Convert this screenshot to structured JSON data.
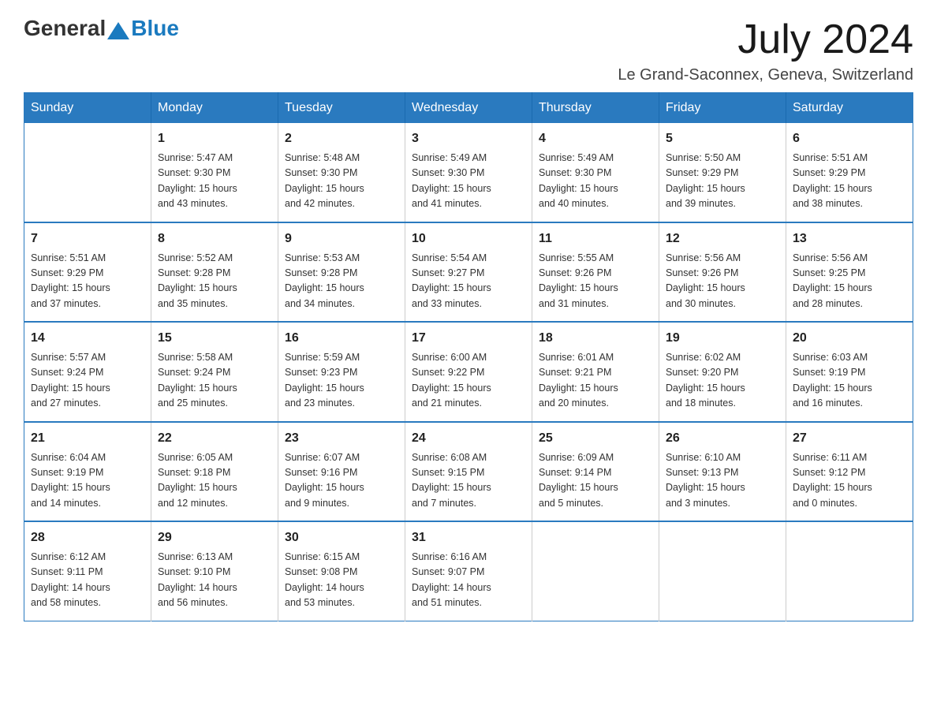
{
  "logo": {
    "general": "General",
    "blue": "Blue"
  },
  "header": {
    "month_year": "July 2024",
    "location": "Le Grand-Saconnex, Geneva, Switzerland"
  },
  "days_of_week": [
    "Sunday",
    "Monday",
    "Tuesday",
    "Wednesday",
    "Thursday",
    "Friday",
    "Saturday"
  ],
  "weeks": [
    [
      {
        "day": "",
        "info": ""
      },
      {
        "day": "1",
        "info": "Sunrise: 5:47 AM\nSunset: 9:30 PM\nDaylight: 15 hours\nand 43 minutes."
      },
      {
        "day": "2",
        "info": "Sunrise: 5:48 AM\nSunset: 9:30 PM\nDaylight: 15 hours\nand 42 minutes."
      },
      {
        "day": "3",
        "info": "Sunrise: 5:49 AM\nSunset: 9:30 PM\nDaylight: 15 hours\nand 41 minutes."
      },
      {
        "day": "4",
        "info": "Sunrise: 5:49 AM\nSunset: 9:30 PM\nDaylight: 15 hours\nand 40 minutes."
      },
      {
        "day": "5",
        "info": "Sunrise: 5:50 AM\nSunset: 9:29 PM\nDaylight: 15 hours\nand 39 minutes."
      },
      {
        "day": "6",
        "info": "Sunrise: 5:51 AM\nSunset: 9:29 PM\nDaylight: 15 hours\nand 38 minutes."
      }
    ],
    [
      {
        "day": "7",
        "info": "Sunrise: 5:51 AM\nSunset: 9:29 PM\nDaylight: 15 hours\nand 37 minutes."
      },
      {
        "day": "8",
        "info": "Sunrise: 5:52 AM\nSunset: 9:28 PM\nDaylight: 15 hours\nand 35 minutes."
      },
      {
        "day": "9",
        "info": "Sunrise: 5:53 AM\nSunset: 9:28 PM\nDaylight: 15 hours\nand 34 minutes."
      },
      {
        "day": "10",
        "info": "Sunrise: 5:54 AM\nSunset: 9:27 PM\nDaylight: 15 hours\nand 33 minutes."
      },
      {
        "day": "11",
        "info": "Sunrise: 5:55 AM\nSunset: 9:26 PM\nDaylight: 15 hours\nand 31 minutes."
      },
      {
        "day": "12",
        "info": "Sunrise: 5:56 AM\nSunset: 9:26 PM\nDaylight: 15 hours\nand 30 minutes."
      },
      {
        "day": "13",
        "info": "Sunrise: 5:56 AM\nSunset: 9:25 PM\nDaylight: 15 hours\nand 28 minutes."
      }
    ],
    [
      {
        "day": "14",
        "info": "Sunrise: 5:57 AM\nSunset: 9:24 PM\nDaylight: 15 hours\nand 27 minutes."
      },
      {
        "day": "15",
        "info": "Sunrise: 5:58 AM\nSunset: 9:24 PM\nDaylight: 15 hours\nand 25 minutes."
      },
      {
        "day": "16",
        "info": "Sunrise: 5:59 AM\nSunset: 9:23 PM\nDaylight: 15 hours\nand 23 minutes."
      },
      {
        "day": "17",
        "info": "Sunrise: 6:00 AM\nSunset: 9:22 PM\nDaylight: 15 hours\nand 21 minutes."
      },
      {
        "day": "18",
        "info": "Sunrise: 6:01 AM\nSunset: 9:21 PM\nDaylight: 15 hours\nand 20 minutes."
      },
      {
        "day": "19",
        "info": "Sunrise: 6:02 AM\nSunset: 9:20 PM\nDaylight: 15 hours\nand 18 minutes."
      },
      {
        "day": "20",
        "info": "Sunrise: 6:03 AM\nSunset: 9:19 PM\nDaylight: 15 hours\nand 16 minutes."
      }
    ],
    [
      {
        "day": "21",
        "info": "Sunrise: 6:04 AM\nSunset: 9:19 PM\nDaylight: 15 hours\nand 14 minutes."
      },
      {
        "day": "22",
        "info": "Sunrise: 6:05 AM\nSunset: 9:18 PM\nDaylight: 15 hours\nand 12 minutes."
      },
      {
        "day": "23",
        "info": "Sunrise: 6:07 AM\nSunset: 9:16 PM\nDaylight: 15 hours\nand 9 minutes."
      },
      {
        "day": "24",
        "info": "Sunrise: 6:08 AM\nSunset: 9:15 PM\nDaylight: 15 hours\nand 7 minutes."
      },
      {
        "day": "25",
        "info": "Sunrise: 6:09 AM\nSunset: 9:14 PM\nDaylight: 15 hours\nand 5 minutes."
      },
      {
        "day": "26",
        "info": "Sunrise: 6:10 AM\nSunset: 9:13 PM\nDaylight: 15 hours\nand 3 minutes."
      },
      {
        "day": "27",
        "info": "Sunrise: 6:11 AM\nSunset: 9:12 PM\nDaylight: 15 hours\nand 0 minutes."
      }
    ],
    [
      {
        "day": "28",
        "info": "Sunrise: 6:12 AM\nSunset: 9:11 PM\nDaylight: 14 hours\nand 58 minutes."
      },
      {
        "day": "29",
        "info": "Sunrise: 6:13 AM\nSunset: 9:10 PM\nDaylight: 14 hours\nand 56 minutes."
      },
      {
        "day": "30",
        "info": "Sunrise: 6:15 AM\nSunset: 9:08 PM\nDaylight: 14 hours\nand 53 minutes."
      },
      {
        "day": "31",
        "info": "Sunrise: 6:16 AM\nSunset: 9:07 PM\nDaylight: 14 hours\nand 51 minutes."
      },
      {
        "day": "",
        "info": ""
      },
      {
        "day": "",
        "info": ""
      },
      {
        "day": "",
        "info": ""
      }
    ]
  ]
}
